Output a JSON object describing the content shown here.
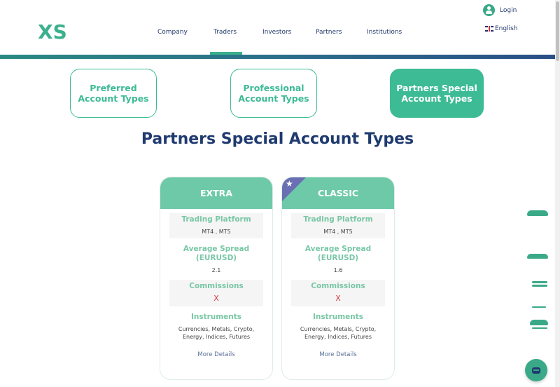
{
  "header": {
    "logo_text": "XS",
    "nav": [
      "Company",
      "Traders",
      "Investors",
      "Partners",
      "Institutions"
    ],
    "login_label": "Login",
    "language_label": "English",
    "active_nav": "Traders"
  },
  "tabs": [
    {
      "label": "Preferred Account Types",
      "active": false
    },
    {
      "label": "Professional Account Types",
      "active": false
    },
    {
      "label": "Partners Special Account Types",
      "active": true
    }
  ],
  "section_title": "Partners Special Account Types",
  "cards": [
    {
      "title": "EXTRA",
      "featured": false,
      "trading_platform_label": "Trading Platform",
      "trading_platform_value": "MT4 , MT5",
      "spread_label": "Average Spread (EURUSD)",
      "spread_value": "2.1",
      "commissions_label": "Commissions",
      "commissions_value": "X",
      "instruments_label": "Instruments",
      "instruments_value": "Currencies, Metals, Crypto, Energy, Indices, Futures",
      "more_label": "More Details"
    },
    {
      "title": "CLASSIC",
      "featured": true,
      "trading_platform_label": "Trading Platform",
      "trading_platform_value": "MT4 , MT5",
      "spread_label": "Average Spread (EURUSD)",
      "spread_value": "1.6",
      "commissions_label": "Commissions",
      "commissions_value": "X",
      "instruments_label": "Instruments",
      "instruments_value": "Currencies, Metals, Crypto, Energy, Indices, Futures",
      "more_label": "More Details"
    }
  ],
  "colors": {
    "brand_green": "#3dbb95",
    "card_header": "#6dc9a7",
    "navy": "#1f3a6f",
    "ribbon": "#6a6fb3",
    "cross": "#d23d3d"
  },
  "icons": [
    "user-icon",
    "uk-flag-icon",
    "star-icon",
    "chat-icon"
  ]
}
